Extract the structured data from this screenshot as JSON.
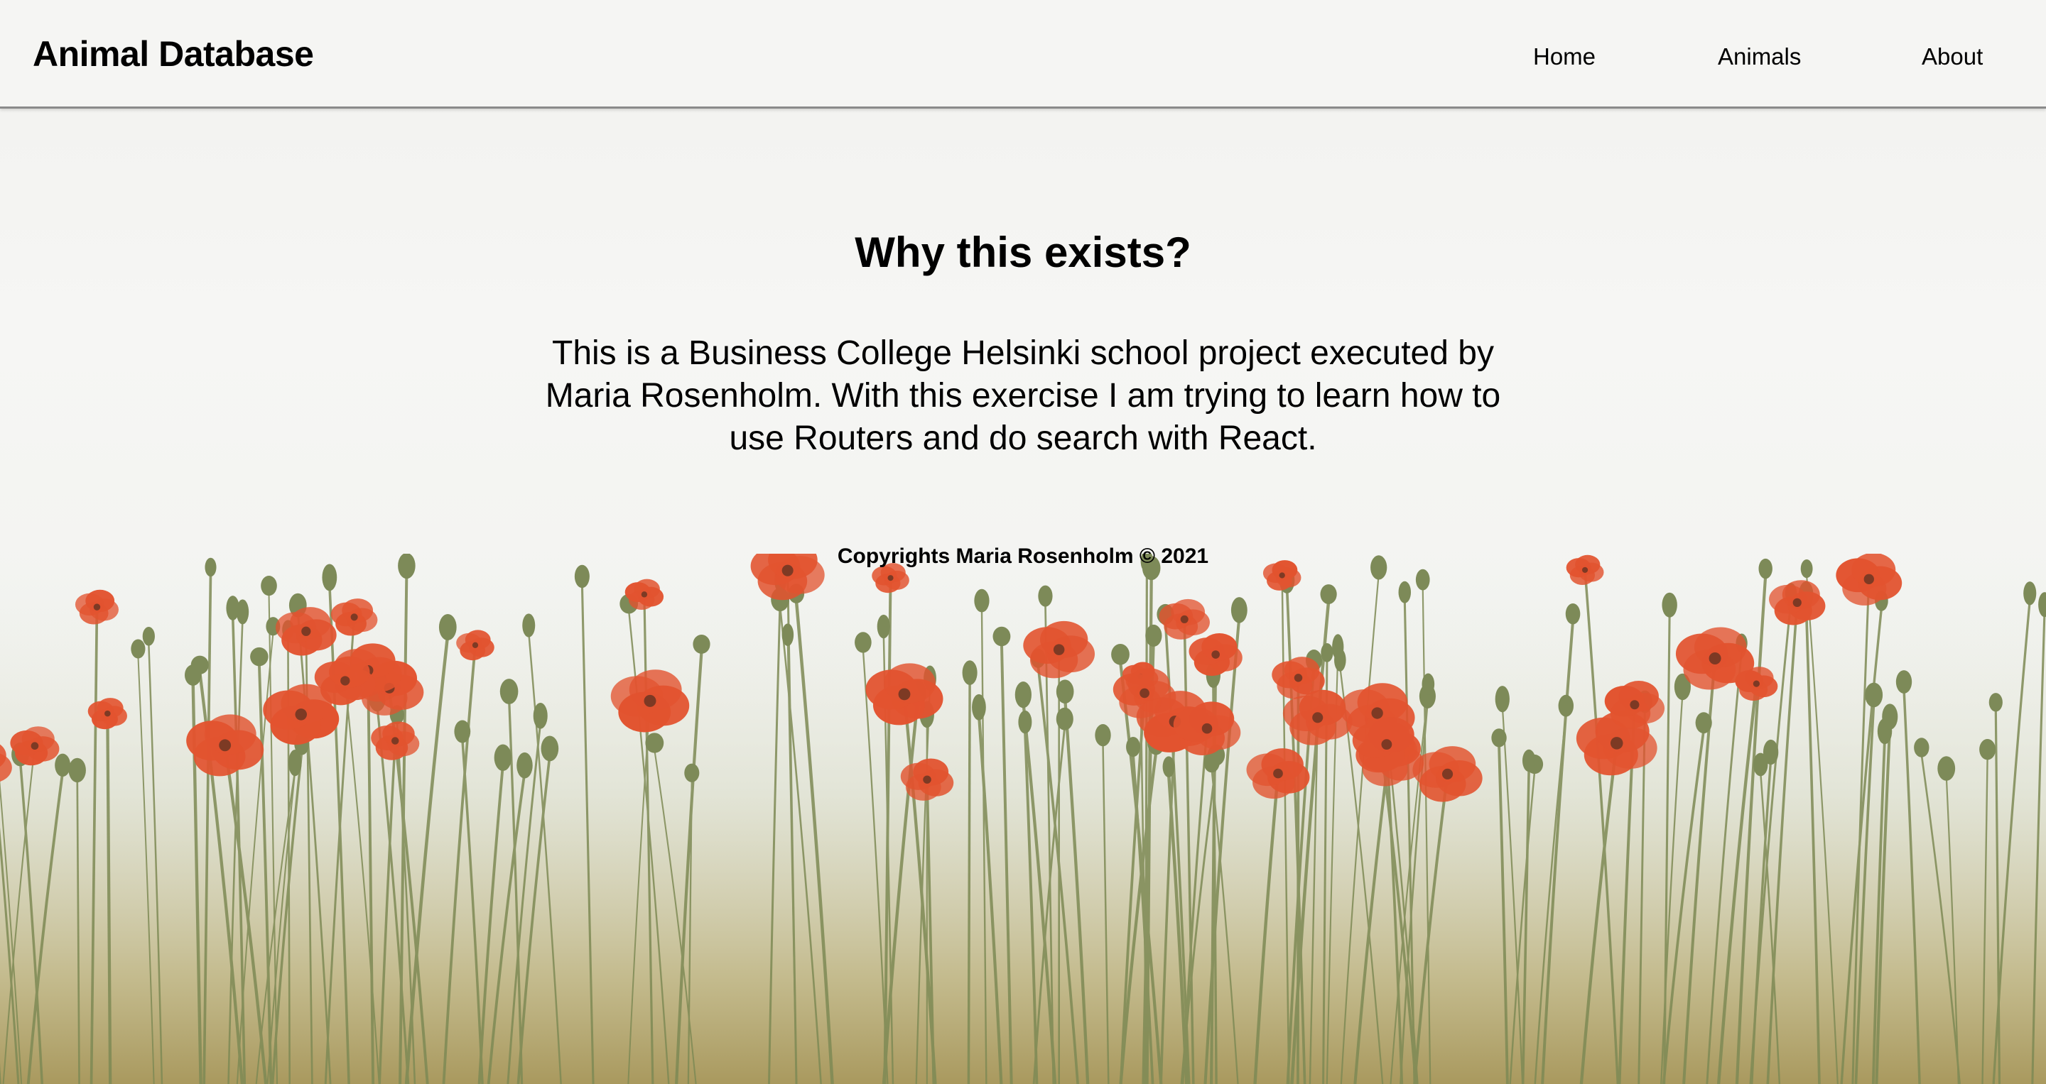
{
  "header": {
    "title": "Animal Database",
    "nav": {
      "home": "Home",
      "animals": "Animals",
      "about": "About"
    }
  },
  "main": {
    "heading": "Why this exists?",
    "description": "This is a Business College Helsinki school project executed by Maria Rosenholm. With this exercise I am trying to learn how to use Routers and do search with React.",
    "copyright": "Copyrights Maria Rosenholm © 2021"
  },
  "colors": {
    "background": "#f4f4f2",
    "poppy": "#e2532f",
    "stem": "#7e8a55",
    "text": "#000000"
  },
  "background_image": "poppy-field"
}
